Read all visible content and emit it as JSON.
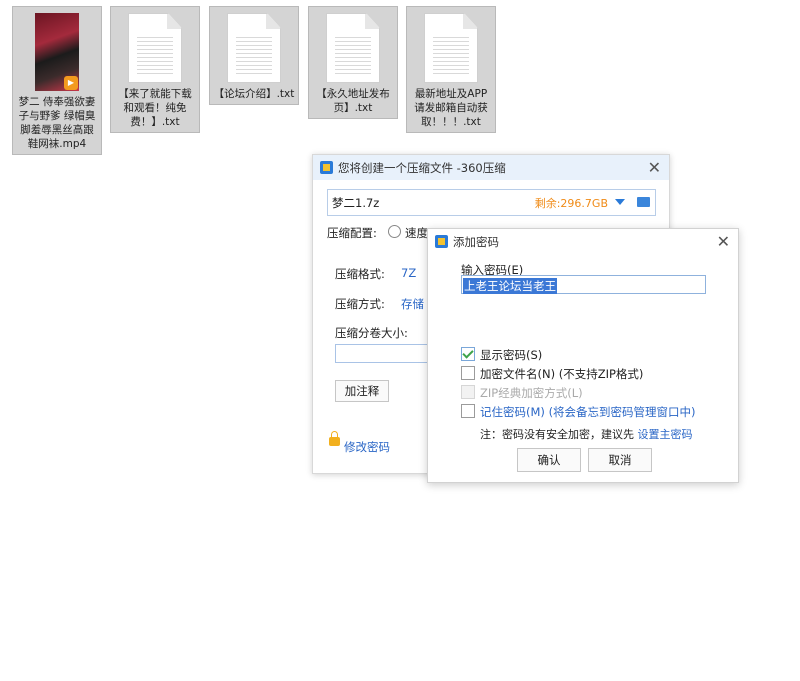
{
  "files": [
    {
      "name": "梦二 侍奉强欲妻子与野爹 绿帽臭脚羞辱黑丝高跟鞋网袜.mp4",
      "type": "video",
      "icon": "video-file-icon"
    },
    {
      "name": "【来了就能下载和观看！纯免费！】.txt",
      "type": "text",
      "icon": "text-file-icon"
    },
    {
      "name": "【论坛介绍】.txt",
      "type": "text",
      "icon": "text-file-icon"
    },
    {
      "name": "【永久地址发布页】.txt",
      "type": "text",
      "icon": "text-file-icon"
    },
    {
      "name": "最新地址及APP请发邮箱自动获取！！！.txt",
      "type": "text",
      "icon": "text-file-icon"
    }
  ],
  "compress_window": {
    "title": "您将创建一个压缩文件 -360压缩",
    "archive_name": "梦二1.7z",
    "free_space": "剩余:296.7GB",
    "config_label": "压缩配置:",
    "options": [
      "速度"
    ],
    "format_label": "压缩格式:",
    "format_value": "7Z",
    "method_label": "压缩方式:",
    "method_value": "存储",
    "split_label": "压缩分卷大小:",
    "comment_button": "加注释",
    "change_password": "修改密码"
  },
  "password_dialog": {
    "title": "添加密码",
    "input_label": "输入密码(E)",
    "password_value": "上老王论坛当老王",
    "show_password": "显示密码(S)",
    "show_password_checked": true,
    "encrypt_filename": "加密文件名(N) (不支持ZIP格式)",
    "encrypt_filename_checked": false,
    "zip_classic": "ZIP经典加密方式(L)",
    "remember_password": "记住密码(M)",
    "remember_note": "(将会备忘到密码管理窗口中)",
    "note_text": "注：密码没有安全加密，建议先",
    "note_link": "设置主密码",
    "ok_button": "确认",
    "cancel_button": "取消"
  },
  "colors": {
    "accent": "#2a66c6",
    "free_space": "#f08b17",
    "selection": "#3b78d6"
  }
}
